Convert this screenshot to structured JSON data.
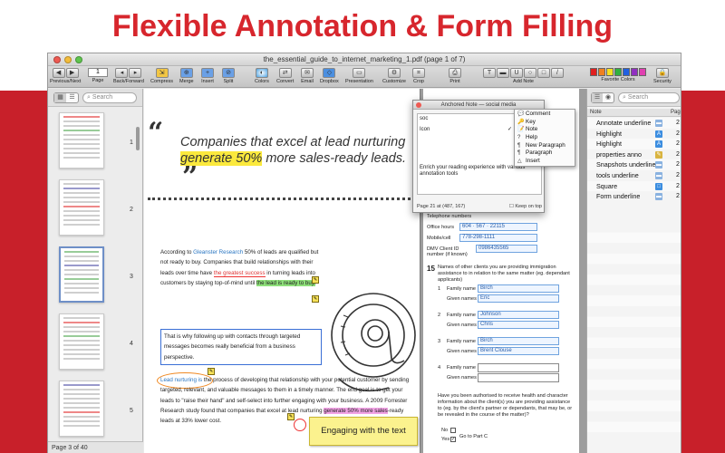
{
  "headline": "Flexible Annotation & Form Filling",
  "window": {
    "title": "the_essential_guide_to_internet_marketing_1.pdf (page 1 of 7)"
  },
  "toolbar": {
    "page_value": "1",
    "items": [
      {
        "label": "Previous/Next"
      },
      {
        "label": "Page"
      },
      {
        "label": "Back/Forward"
      },
      {
        "label": "Compress"
      },
      {
        "label": "Merge"
      },
      {
        "label": "Insert"
      },
      {
        "label": "Split"
      },
      {
        "label": "Colors"
      },
      {
        "label": "Convert"
      },
      {
        "label": "Email"
      },
      {
        "label": "Dropbox"
      },
      {
        "label": "Presentation"
      },
      {
        "label": "Customize"
      },
      {
        "label": "Crop"
      },
      {
        "label": "Print"
      },
      {
        "label": "Add Note"
      },
      {
        "label": "Favorite Colors"
      },
      {
        "label": "Security"
      }
    ],
    "favorite_colors": [
      "#e02020",
      "#f08020",
      "#f5e020",
      "#30b040",
      "#2060e0",
      "#9030c0",
      "#e040b0"
    ]
  },
  "thumbs": {
    "search_placeholder": "Search",
    "numbers": [
      "1",
      "2",
      "3",
      "4",
      "5"
    ],
    "status": "Page 3 of 40"
  },
  "page1": {
    "quote_open": "“",
    "quote_close": "”",
    "quote_pre": "Companies that excel at lead nurturing ",
    "quote_hl": "generate 50%",
    "quote_post": " more sales-ready leads.",
    "p1_a": "According to ",
    "p1_link": "Gleanster Research",
    "p1_b": " 50% of leads are qualified but not ready to buy. Companies that build relationships with their leads over time have ",
    "p1_red": "the greatest success",
    "p1_c": " in turning leads into customers by staying top-of-mind until ",
    "p1_green": "the lead is ready to buy.",
    "p2": "That is why following up with contacts through targeted messages becomes really beneficial from a business perspective.",
    "p3_link": "Lead nurturing is",
    "p3_a": " the process of developing that relationship with your potential customer by sending targeted, relevant, and valuable messages to them in a timely manner. The end goal is to get your leads to \"raise their hand\" and self-select into further engaging with your business. A 2009 Forrester Research study found that companies that excel at lead nurturing ",
    "p3_pink": "generate 50% more sales",
    "p3_b": "-ready leads at 33% lower cost.",
    "sticky": "Engaging with the text"
  },
  "popup": {
    "title": "Anchored Note — social media",
    "row1": "soc",
    "row2": "Icon",
    "body": "Enrich your reading experience with various annotation tools",
    "footer_left": "Page 21 at (487, 167)",
    "footer_right": "Keep on top"
  },
  "menu": {
    "items": [
      {
        "icon": "💬",
        "label": "Comment"
      },
      {
        "icon": "🔑",
        "label": "Key"
      },
      {
        "icon": "📝",
        "label": "Note"
      },
      {
        "icon": "?",
        "label": "Help"
      },
      {
        "icon": "¶",
        "label": "New Paragraph"
      },
      {
        "icon": "¶",
        "label": "Paragraph"
      },
      {
        "icon": "△",
        "label": "Insert"
      }
    ]
  },
  "form": {
    "telephone": "Telephone numbers",
    "office_hours": "Office hours",
    "office_hours_value": "604 · 567 · 22115",
    "mobile": "Mobile/cell",
    "mobile_value": "778-298-1111",
    "dmv": "DMV Client ID number (if known)",
    "dmv_value": "0986435565",
    "q15_num": "15",
    "q15_text": "Names of other clients you are providing immigration assistance to in relation to the same matter (eg. dependant applicants)",
    "family_name": "Family name",
    "given_names": "Given names",
    "entries": [
      {
        "num": "1",
        "family": "Birch",
        "given": "Eric"
      },
      {
        "num": "2",
        "family": "Johnson",
        "given": "Chris"
      },
      {
        "num": "3",
        "family": "Birch",
        "given": "Brent Clouse"
      },
      {
        "num": "4",
        "family": "",
        "given": ""
      }
    ],
    "q16_text": "Have you been authorised to receive health and character information about the client(s) you are providing assistance to (eg. by the client's partner or dependants, that may be, or be revealed in the course of the matter)?",
    "no_label": "No",
    "yes_label": "Yes",
    "go_label": "Go to Part C"
  },
  "notes": {
    "search_placeholder": "Search",
    "col_note": "Note",
    "col_page": "Page",
    "rows": [
      {
        "label": "Annotate underline",
        "page": "2",
        "icon": "highlight-icon",
        "color": "#8ab2e0"
      },
      {
        "label": "Highlight",
        "page": "2",
        "icon": "A",
        "color": "#3d8ee0"
      },
      {
        "label": "Highlight",
        "page": "2",
        "icon": "A",
        "color": "#3d8ee0"
      },
      {
        "label": "properties anno",
        "page": "2",
        "icon": "note-icon",
        "color": "#d9b440"
      },
      {
        "label": "Snapshots underline",
        "page": "2",
        "icon": "highlight-icon",
        "color": "#8ab2e0"
      },
      {
        "label": "tools underline",
        "page": "2",
        "icon": "highlight-icon",
        "color": "#8ab2e0"
      },
      {
        "label": "Square",
        "page": "2",
        "icon": "square-icon",
        "color": "#3d8ee0"
      },
      {
        "label": "Form underline",
        "page": "2",
        "icon": "highlight-icon",
        "color": "#8ab2e0"
      }
    ]
  }
}
